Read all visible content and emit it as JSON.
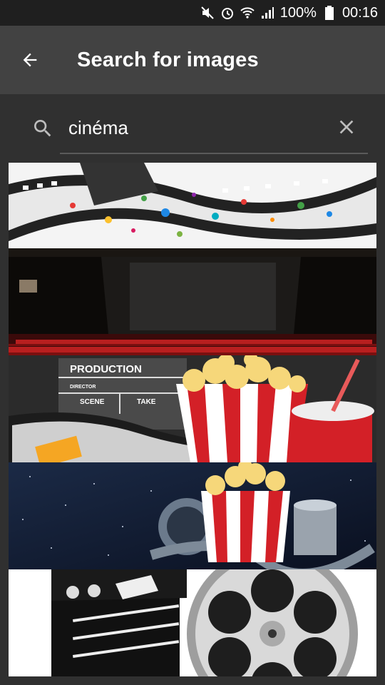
{
  "status_bar": {
    "battery": "100%",
    "time": "00:16",
    "icons": [
      "mute-icon",
      "alarm-icon",
      "wifi-icon",
      "signal-icon",
      "battery-icon"
    ]
  },
  "app_bar": {
    "title": "Search for images",
    "back_icon": "arrow-back-icon"
  },
  "search": {
    "query": "cinéma",
    "search_icon": "search-icon",
    "clear_icon": "close-icon"
  },
  "results": [
    {
      "subject": "film strip with colorful paint splatter"
    },
    {
      "subject": "empty cinema theater with red seats"
    },
    {
      "subject": "clapperboard with popcorn and soda",
      "text": [
        "PRODUCTION",
        "DIRECTOR",
        "SCENE",
        "TAKE"
      ]
    },
    {
      "subject": "popcorn and film reels on starry background"
    },
    {
      "subject": "clapperboard and film reel"
    }
  ],
  "colors": {
    "background": "#303030",
    "app_bar": "#424242",
    "status_bar": "#1f1f1f",
    "accent_red": "#d32027"
  }
}
